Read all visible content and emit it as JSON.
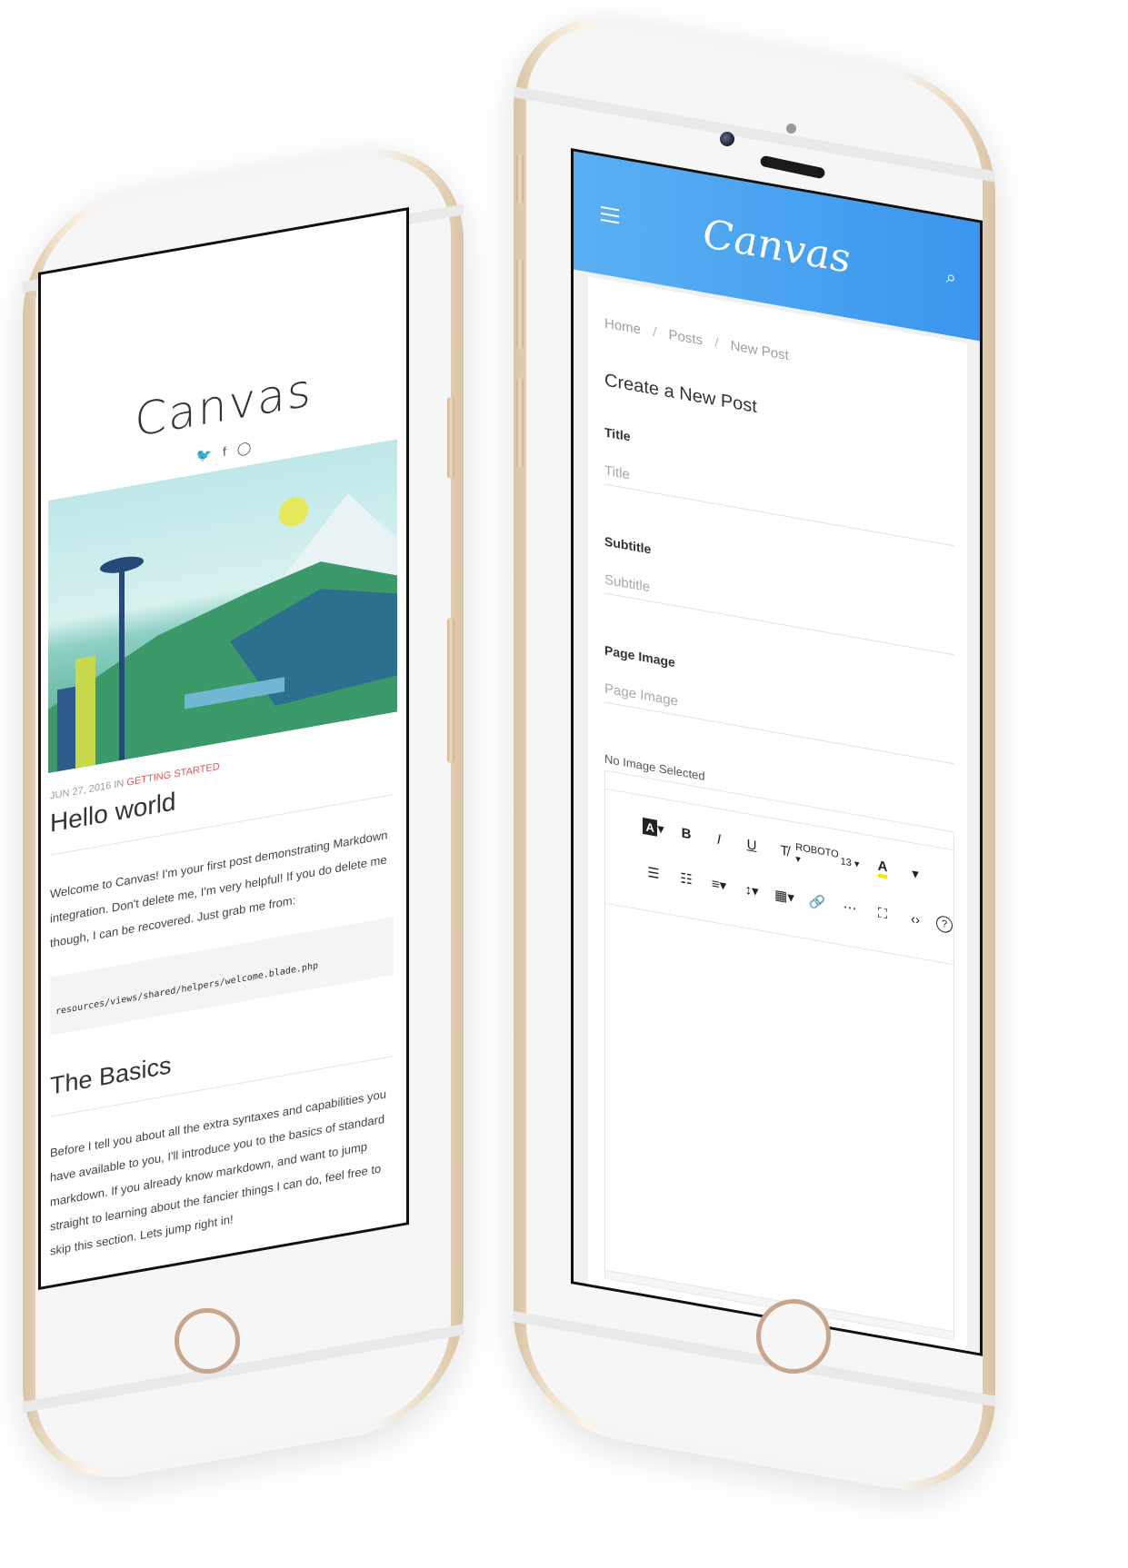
{
  "left_phone": {
    "blog": {
      "title": "Canvas",
      "social": {
        "twitter": "🐦",
        "facebook": "f",
        "github": "◯"
      },
      "post": {
        "date": "JUN 27, 2016 IN",
        "category": "GETTING STARTED",
        "title": "Hello world",
        "intro": "Welcome to Canvas! I'm your first post demonstrating Markdown integration. Don't delete me, I'm very helpful! If you do delete me though, I can be recovered. Just grab me from:",
        "code": "resources/views/shared/helpers/welcome.blade.php",
        "section_title": "The Basics",
        "section_text": "Before I tell you about all the extra syntaxes and capabilities you have available to you, I'll introduce you to the basics of standard markdown. If you already know markdown, and want to jump straight to learning about the fancier things I can do, feel free to skip this section. Lets jump right in!"
      }
    }
  },
  "right_phone": {
    "header": {
      "brand": "Canvas",
      "search_icon": "⌕"
    },
    "breadcrumb": {
      "home": "Home",
      "posts": "Posts",
      "current": "New Post",
      "separator": "/"
    },
    "form": {
      "heading": "Create a New Post",
      "title_label": "Title",
      "title_placeholder": "Title",
      "subtitle_label": "Subtitle",
      "subtitle_placeholder": "Subtitle",
      "image_label": "Page Image",
      "image_placeholder": "Page Image",
      "no_image": "No Image Selected"
    },
    "editor_toolbar": {
      "style": "A",
      "bold": "B",
      "italic": "I",
      "underline": "U",
      "clear": "T̸",
      "font": "ROBOTO ▾",
      "size": "13 ▾",
      "color": "A",
      "color_caret": "▾",
      "unordered_list": "☰",
      "ordered_list": "☷",
      "align": "≡▾",
      "line_height": "↕▾",
      "table": "▦▾",
      "link": "🔗",
      "hr": "⋯",
      "fullscreen": "⛶",
      "code": "‹›",
      "help": "?"
    }
  }
}
